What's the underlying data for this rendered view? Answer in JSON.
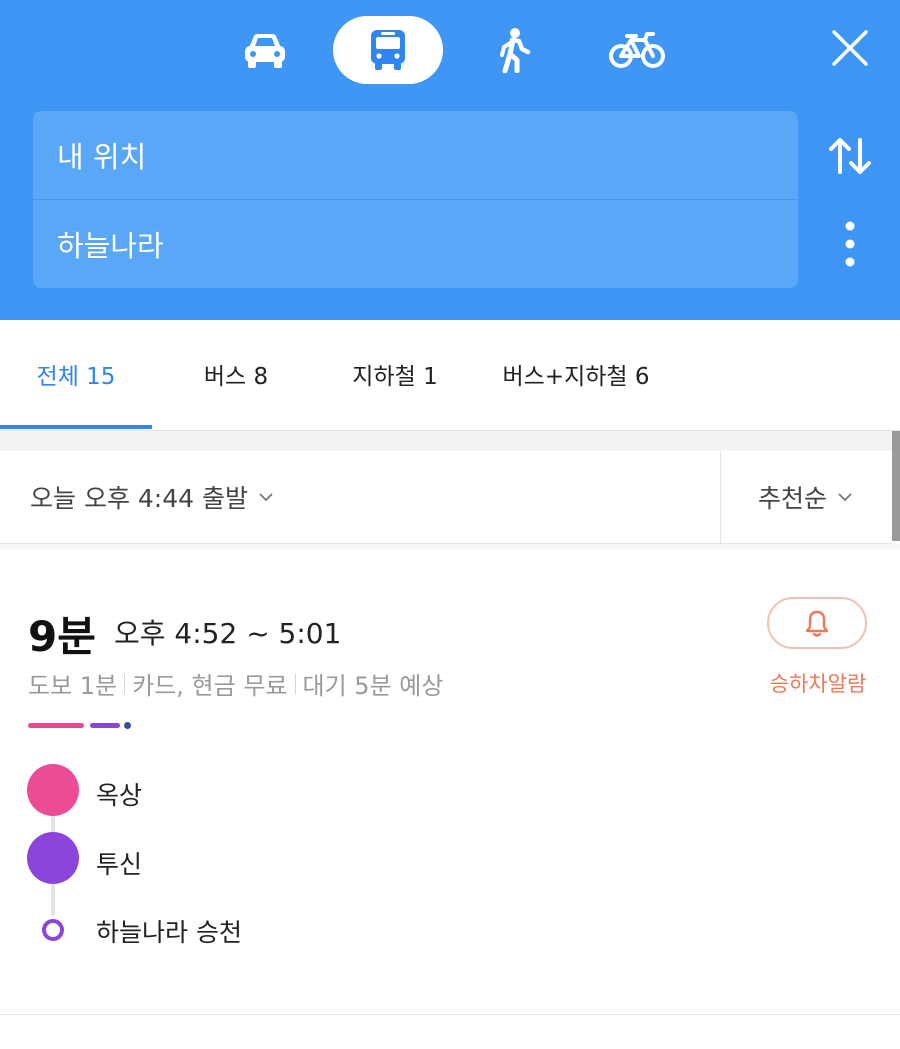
{
  "transport_modes": [
    {
      "name": "car-icon",
      "selected": false
    },
    {
      "name": "bus-icon",
      "selected": true
    },
    {
      "name": "walk-icon",
      "selected": false
    },
    {
      "name": "bike-icon",
      "selected": false
    }
  ],
  "route": {
    "origin": "내 위치",
    "destination": "하늘나라"
  },
  "tabs": [
    {
      "label": "전체 15",
      "active": true
    },
    {
      "label": "버스 8",
      "active": false
    },
    {
      "label": "지하철 1",
      "active": false
    },
    {
      "label": "버스+지하철 6",
      "active": false
    }
  ],
  "filters": {
    "departure": "오늘 오후 4:44 출발",
    "sort": "추천순"
  },
  "result": {
    "duration": "9분",
    "time_range": "오후 4:52 ~ 5:01",
    "walk": "도보 1분",
    "fare": "카드, 현금 무료",
    "wait": "대기 5분 예상",
    "alarm_label": "승하차알람",
    "stops": [
      {
        "name": "옥상",
        "color": "#ec4b95"
      },
      {
        "name": "투신",
        "color": "#8b45db"
      },
      {
        "name": "하늘나라 승천",
        "color": "#8b45db"
      }
    ]
  },
  "colors": {
    "header": "#3f96f5",
    "accent": "#2f86f0",
    "alarm": "#ec7a57"
  }
}
